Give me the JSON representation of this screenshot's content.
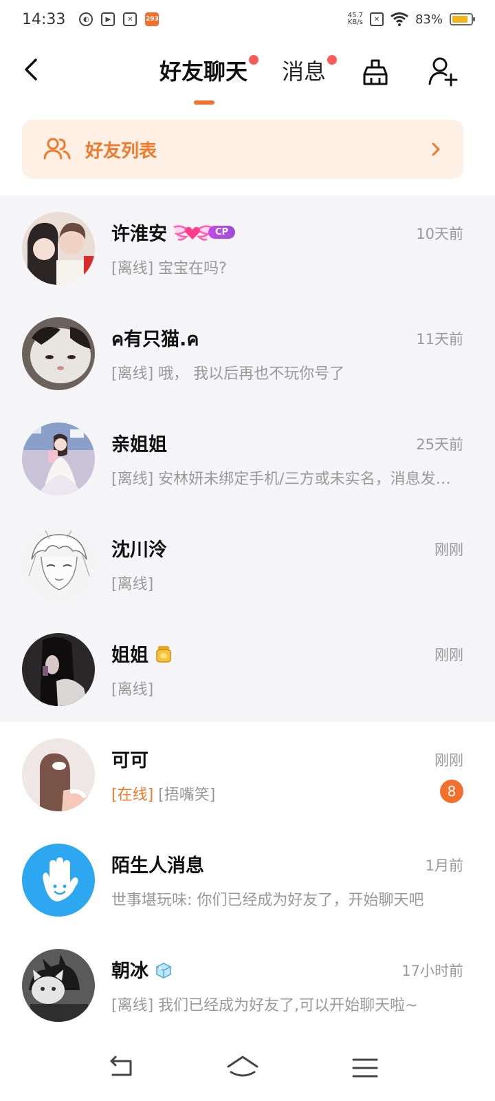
{
  "status_bar": {
    "time": "14:33",
    "notification_badge": "293",
    "net_speed_value": "45.7",
    "net_speed_unit": "KB/s",
    "battery": "83%",
    "battery_level": 0.83
  },
  "header": {
    "tab_friends": "好友聊天",
    "tab_messages": "消息"
  },
  "banner": {
    "label": "好友列表"
  },
  "chats": [
    {
      "name": "许淮安",
      "time": "10天前",
      "status": "[离线]",
      "preview": " 宝宝在吗?",
      "badge": "CP",
      "pinned": true
    },
    {
      "name": "ค有只猫.ค",
      "time": "11天前",
      "status": "[离线]",
      "preview": " 哦， 我以后再也不玩你号了",
      "pinned": true
    },
    {
      "name": "亲姐姐",
      "time": "25天前",
      "status": "[离线]",
      "preview": " 安林妍未绑定手机/三方或未实名，消息发送失败",
      "pinned": true
    },
    {
      "name": "沈川泠",
      "time": "刚刚",
      "status": "[离线]",
      "preview": "",
      "pinned": true
    },
    {
      "name": "姐姐",
      "time": "刚刚",
      "status": "[离线]",
      "preview": "",
      "icon": "honey-jar-icon",
      "pinned": true
    },
    {
      "name": "可可",
      "time": "刚刚",
      "status": "[在线]",
      "preview": " [捂嘴笑]",
      "unread": "8",
      "pinned": false
    },
    {
      "name": "陌生人消息",
      "time": "1月前",
      "status": "",
      "preview": "世事堪玩味: 你们已经成为好友了，开始聊天吧",
      "pinned": false
    },
    {
      "name": "朝冰",
      "time": "17小时前",
      "status": "[离线]",
      "preview": " 我们已经成为好友了,可以开始聊天啦~",
      "icon": "ice-cube-icon",
      "pinned": false
    }
  ],
  "colors": {
    "accent": "#f26f2e",
    "banner_bg": "#fff0e6",
    "pinned_bg": "#f5f5f7",
    "red_dot": "#ff5a5a",
    "stranger_avatar": "#2ea7f1"
  }
}
